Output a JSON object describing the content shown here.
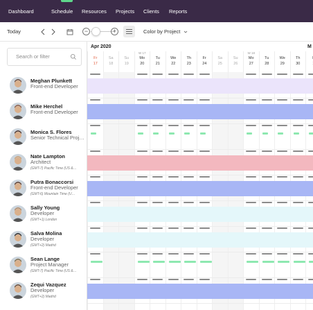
{
  "nav": {
    "items": [
      "Dashboard",
      "Schedule",
      "Resources",
      "Projects",
      "Clients",
      "Reports"
    ],
    "active_index": 1,
    "accent": "#5fd78b",
    "background": "#3a2a47"
  },
  "toolbar": {
    "today_label": "Today",
    "prev_icon": "chevron-left-icon",
    "next_icon": "chevron-right-icon",
    "calendar_icon": "calendar-icon",
    "zoom_out_label": "−",
    "zoom_in_label": "+",
    "list_icon": "list-icon",
    "color_by_label": "Color by Project",
    "color_by_icon": "chevron-down-icon"
  },
  "search": {
    "placeholder": "Search or filter",
    "icon": "search-icon"
  },
  "calendar": {
    "month_labels": [
      "Apr 2020",
      "M"
    ],
    "days": [
      {
        "dn": "Fr",
        "dd": "17",
        "week": "",
        "weekend": false,
        "today": true
      },
      {
        "dn": "Sa",
        "dd": "18",
        "week": "",
        "weekend": true,
        "today": false
      },
      {
        "dn": "Su",
        "dd": "19",
        "week": "",
        "weekend": true,
        "today": false
      },
      {
        "dn": "Mo",
        "dd": "20",
        "week": "W 17",
        "weekend": false,
        "today": false
      },
      {
        "dn": "Tu",
        "dd": "21",
        "week": "",
        "weekend": false,
        "today": false
      },
      {
        "dn": "We",
        "dd": "22",
        "week": "",
        "weekend": false,
        "today": false
      },
      {
        "dn": "Th",
        "dd": "23",
        "week": "",
        "weekend": false,
        "today": false
      },
      {
        "dn": "Fr",
        "dd": "24",
        "week": "",
        "weekend": false,
        "today": false
      },
      {
        "dn": "Sa",
        "dd": "25",
        "week": "",
        "weekend": true,
        "today": false
      },
      {
        "dn": "Su",
        "dd": "26",
        "week": "",
        "weekend": true,
        "today": false
      },
      {
        "dn": "Mo",
        "dd": "27",
        "week": "W 18",
        "weekend": false,
        "today": false
      },
      {
        "dn": "Tu",
        "dd": "28",
        "week": "",
        "weekend": false,
        "today": false
      },
      {
        "dn": "We",
        "dd": "29",
        "week": "",
        "weekend": false,
        "today": false
      },
      {
        "dn": "Th",
        "dd": "30",
        "week": "",
        "weekend": false,
        "today": false
      },
      {
        "dn": "F",
        "dd": "1",
        "week": "",
        "weekend": false,
        "today": false
      }
    ]
  },
  "people": [
    {
      "name": "Meghan Plunkett",
      "role": "Front-end Developer",
      "info": "",
      "avatar_color": "#6b4a3a",
      "bar_color": "#ebe4fb",
      "green": false
    },
    {
      "name": "Mike Herchel",
      "role": "Front-end Developer",
      "info": "",
      "avatar_color": "#8a5a44",
      "bar_color": "#a8b6f5",
      "green": false
    },
    {
      "name": "Monica S. Flores",
      "role": "Senior Technical Proj…",
      "info": "",
      "avatar_color": "#4a3028",
      "bar_color": "#ffffff",
      "green": true
    },
    {
      "name": "Nate Lampton",
      "role": "Architect",
      "info": "(GMT-7) Pacific Time (US &…",
      "avatar_color": "#c9a27a",
      "bar_color": "#f3b8bf",
      "green": false
    },
    {
      "name": "Putra Bonaccorsi",
      "role": "Front-end Developer",
      "info": "(GMT-6) Mountain Time (U…",
      "avatar_color": "#5a3a2c",
      "bar_color": "#a8b6f5",
      "green": false
    },
    {
      "name": "Sally Young",
      "role": "Developer",
      "info": "(GMT+1) London",
      "avatar_color": "#b08a6a",
      "bar_color": "#e4f7fa",
      "green": false
    },
    {
      "name": "Salva Molina",
      "role": "Developer",
      "info": "(GMT+2) Madrid",
      "avatar_color": "#2a2a2a",
      "bar_color": "#e4f7fa",
      "green": false
    },
    {
      "name": "Sean Lange",
      "role": "Project Manager",
      "info": "(GMT-7) Pacific Time (US &…",
      "avatar_color": "#7a6a4a",
      "bar_color": "#ffffff",
      "green": true
    },
    {
      "name": "Zequi Vazquez",
      "role": "Developer",
      "info": "(GMT+2) Madrid",
      "avatar_color": "#6a4a34",
      "bar_color": "#a8b6f5",
      "green": false
    }
  ]
}
